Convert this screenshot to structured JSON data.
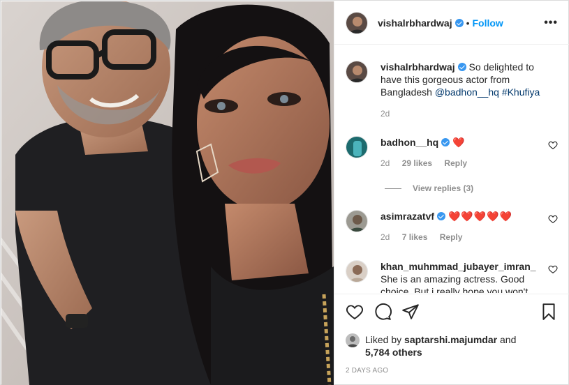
{
  "post": {
    "author": "vishalrbhardwaj",
    "follow_label": "Follow",
    "more_label": "•••",
    "dot": "•"
  },
  "caption": {
    "username": "vishalrbhardwaj",
    "text": "So delighted to have this gorgeous actor from Bangladesh",
    "mention": "@badhon__hq",
    "hashtag": "#Khufiya",
    "time": "2d"
  },
  "comments": [
    {
      "username": "badhon__hq",
      "text": "❤️",
      "time": "2d",
      "likes": "29 likes",
      "reply": "Reply",
      "view_replies": "View replies (3)"
    },
    {
      "username": "asimrazatvf",
      "text": "❤️❤️❤️❤️❤️",
      "time": "2d",
      "likes": "7 likes",
      "reply": "Reply"
    },
    {
      "username": "khan_muhmmad_jubayer_imran_",
      "text": "She is an amazing actress. Good choice. But i really hope you won't"
    }
  ],
  "likes": {
    "prefix": "Liked by",
    "user": "saptarshi.majumdar",
    "and": "and",
    "count": "5,784 others"
  },
  "timestamp": "2 DAYS AGO",
  "colors": {
    "accent": "#0095f6",
    "heart": "#ed4956",
    "verified": "#3897f0"
  }
}
